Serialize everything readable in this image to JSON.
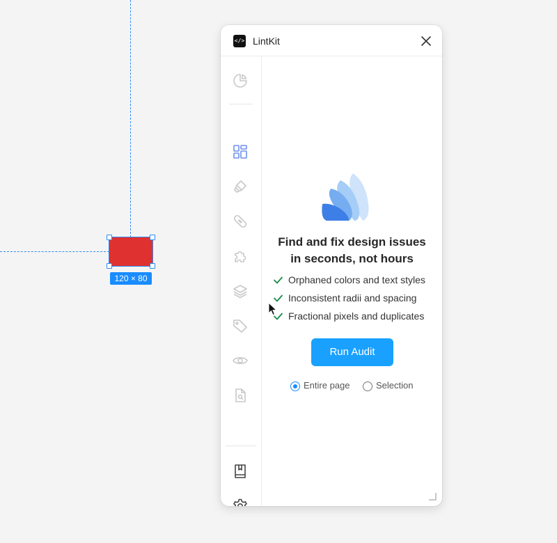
{
  "canvas": {
    "selection_dimensions": "120 × 80",
    "selection_fill": "#e03131",
    "guide_color": "#2d8cf0"
  },
  "plugin": {
    "title": "LintKit",
    "logo_glyph": "</>",
    "close_icon": "close-icon",
    "sidebar": {
      "top_items": [
        "pie-chart-icon"
      ],
      "middle_items": [
        "components-grid-icon",
        "paint-brush-icon",
        "bandage-icon",
        "puzzle-icon",
        "layers-icon",
        "tag-icon",
        "eye-icon",
        "file-search-icon"
      ],
      "bottom_items": [
        "book-icon",
        "gear-icon"
      ],
      "active_item": "components-grid-icon"
    },
    "headline_line1": "Find and fix design issues",
    "headline_line2": "in seconds, not hours",
    "features": [
      "Orphaned colors and text styles",
      "Inconsistent radii and spacing",
      "Fractional pixels and duplicates"
    ],
    "run_button": "Run Audit",
    "scope_options": [
      {
        "label": "Entire page",
        "selected": true
      },
      {
        "label": "Selection",
        "selected": false
      }
    ],
    "colors": {
      "accent": "#1aa1ff",
      "check": "#1a8a4a",
      "active_icon": "#6f8ff0",
      "inactive_icon": "#c8c8c8"
    }
  }
}
